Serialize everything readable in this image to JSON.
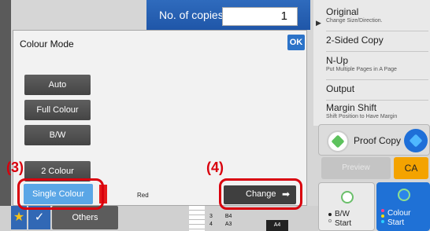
{
  "copies": {
    "label": "No. of copies",
    "value": "1"
  },
  "side_menu": {
    "items": [
      {
        "title": "Original",
        "sub": "Change Size/Direction."
      },
      {
        "title": "2-Sided Copy",
        "sub": ""
      },
      {
        "title": "N-Up",
        "sub": "Put Multiple Pages in A Page"
      },
      {
        "title": "Output",
        "sub": ""
      },
      {
        "title": "Margin Shift",
        "sub": "Shift Position to Have Margin"
      }
    ]
  },
  "proof_copy": {
    "label": "Proof Copy"
  },
  "preview": {
    "label": "Preview"
  },
  "ca": {
    "label": "CA"
  },
  "bw_start": {
    "line1": "B/W",
    "line2": "Start"
  },
  "colour_start": {
    "line1": "Colour",
    "line2": "Start"
  },
  "bottom": {
    "others_label": "Others",
    "trays": [
      {
        "num": "3",
        "size": "B4"
      },
      {
        "num": "4",
        "size": "A3"
      }
    ],
    "paper_size": "A4"
  },
  "dialog": {
    "title": "Colour Mode",
    "ok_label": "OK",
    "modes": [
      "Auto",
      "Full Colour",
      "B/W",
      "2 Colour"
    ],
    "single_colour_label": "Single Colour",
    "selected_colour": "Red",
    "change_label": "Change"
  },
  "annotations": {
    "step3": "(3)",
    "step4": "(4)"
  },
  "colors": {
    "highlight": "#d9000d",
    "accent_blue": "#2c73c8",
    "ca_orange": "#f4a300"
  }
}
